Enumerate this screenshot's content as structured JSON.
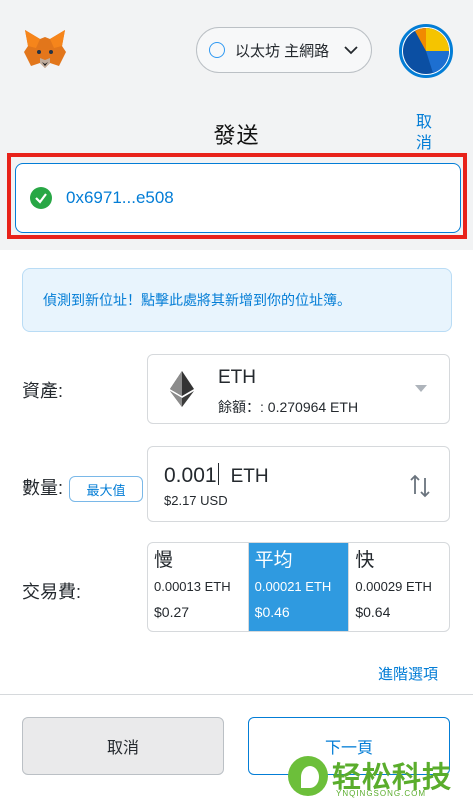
{
  "header": {
    "network_label": "以太坊 主網路",
    "title": "發送",
    "cancel_label": "取消"
  },
  "recipient": {
    "address": "0x6971...e508"
  },
  "notice": {
    "text": "偵測到新位址！點擊此處將其新增到你的位址簿。"
  },
  "asset": {
    "label": "資產:",
    "name": "ETH",
    "balance": "餘額：: 0.270964 ETH"
  },
  "amount": {
    "label": "數量:",
    "max_label": "最大值",
    "value": "0.001",
    "unit": "ETH",
    "fiat": "$2.17 USD"
  },
  "fee": {
    "label": "交易費:",
    "options": [
      {
        "name": "慢",
        "eth": "0.00013 ETH",
        "usd": "$0.27",
        "selected": false
      },
      {
        "name": "平均",
        "eth": "0.00021 ETH",
        "usd": "$0.46",
        "selected": true
      },
      {
        "name": "快",
        "eth": "0.00029 ETH",
        "usd": "$0.64",
        "selected": false
      }
    ]
  },
  "advanced_label": "進階選項",
  "footer": {
    "cancel_label": "取消",
    "next_label": "下一頁"
  },
  "watermark": {
    "title": "轻松科技",
    "subtitle": "YNQINGSONG.COM"
  },
  "colors": {
    "accent": "#037dd6",
    "highlight": "#e8221a",
    "selected_fee": "#2f9ae0",
    "success": "#28a745"
  },
  "icons": [
    "metamask-fox-icon",
    "chevron-down-icon",
    "account-avatar-icon",
    "check-circle-icon",
    "eth-logo-icon",
    "caret-down-icon",
    "swap-arrows-icon"
  ]
}
